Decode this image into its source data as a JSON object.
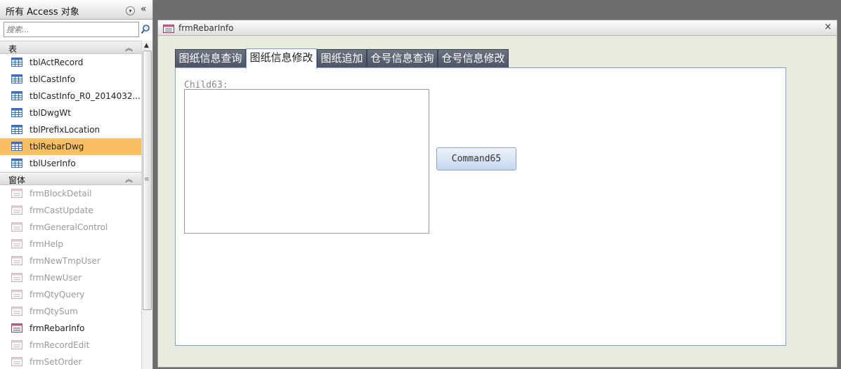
{
  "nav": {
    "title": "所有 Access 对象",
    "dropdown_glyph": "▾",
    "collapse_glyph": "«",
    "search": {
      "placeholder": "搜索..."
    },
    "groups": [
      {
        "label": "表",
        "items": [
          "tblActRecord",
          "tblCastInfo",
          "tblCastInfo_R0_2014032...",
          "tblDwgWt",
          "tblPrefixLocation",
          "tblRebarDwg",
          "tblUserInfo"
        ]
      },
      {
        "label": "窗体",
        "items": [
          "frmBlockDetail",
          "frmCastUpdate",
          "frmGeneralControl",
          "frmHelp",
          "frmNewTmpUser",
          "frmNewUser",
          "frmQtyQuery",
          "frmQtySum",
          "frmRebarInfo",
          "frmRecordEdit",
          "frmSetOrder"
        ]
      }
    ]
  },
  "form": {
    "title": "frmRebarInfo",
    "close_glyph": "×",
    "tabs": [
      "图纸信息查询",
      "图纸信息修改",
      "图纸追加",
      "仓号信息查询",
      "仓号信息修改"
    ],
    "active_tab": 1,
    "child_label": "Child63:",
    "command_label": "Command65"
  },
  "colors": {
    "selected_item": "#fbbf63",
    "tab_dark": "#5a6272",
    "tab_page_border": "#7f9ec9",
    "form_background": "#e8ebde"
  },
  "icons": {
    "table": "table-icon",
    "form": "form-icon",
    "search": "search-icon"
  }
}
